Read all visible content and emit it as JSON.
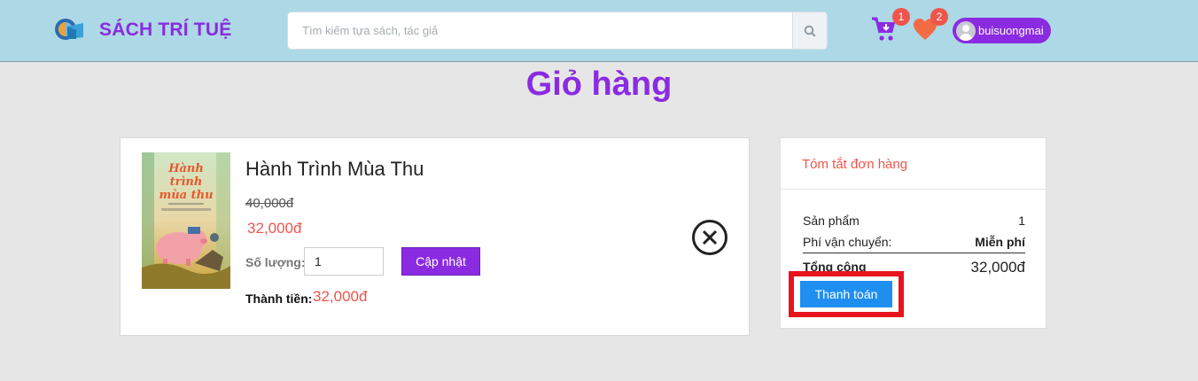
{
  "header": {
    "brand": "SÁCH TRÍ TUỆ",
    "search_placeholder": "Tìm kiếm tựa sách, tác giả",
    "cart_count": "1",
    "wishlist_count": "2",
    "username": "buisuongmai",
    "accent_color": "#8a2be2",
    "header_bg": "#add8e6"
  },
  "page": {
    "title": "Giỏ hàng"
  },
  "cart": {
    "items": [
      {
        "title": "Hành Trình Mùa Thu",
        "cover_text": "Hành trình mùa thu",
        "original_price": "40,000đ",
        "price": "32,000đ",
        "quantity_label": "Số lượng:",
        "quantity": "1",
        "update_label": "Cập nhật",
        "subtotal_label": "Thành tiền:",
        "subtotal": "32,000đ"
      }
    ]
  },
  "summary": {
    "title": "Tóm tắt đơn hàng",
    "products_label": "Sản phẩm",
    "products_value": "1",
    "shipping_label": "Phí vận chuyển:",
    "shipping_value": "Miễn phí",
    "total_label": "Tổng cộng",
    "total_value": "32,000đ",
    "checkout_label": "Thanh toán"
  }
}
